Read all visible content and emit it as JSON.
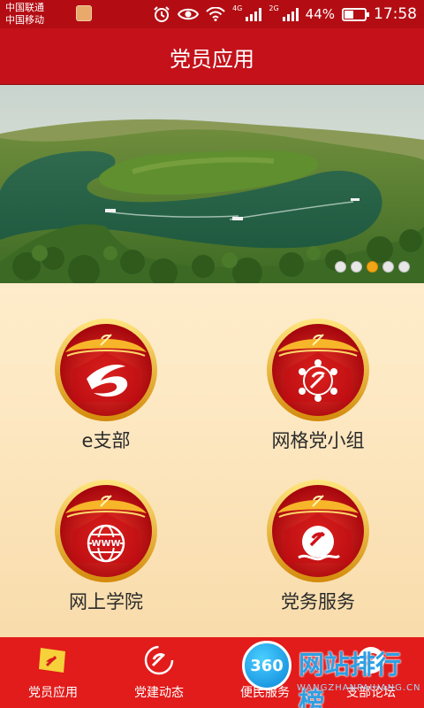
{
  "status_bar": {
    "carrier_1": "中国联通",
    "carrier_2": "中国移动",
    "network_1": "4G",
    "network_2": "2G",
    "battery": "44%",
    "battery_level": 0.44,
    "time": "17:58",
    "icons": [
      "app-icon",
      "alarm-icon",
      "eye-icon",
      "wifi-icon",
      "signal-icon",
      "signal-icon",
      "battery-icon"
    ]
  },
  "header": {
    "title": "党员应用"
  },
  "banner": {
    "slide_count": 5,
    "active_slide": 3
  },
  "apps": [
    {
      "label": "e支部",
      "icon": "e-branch-icon"
    },
    {
      "label": "网格党小组",
      "icon": "network-party-icon"
    },
    {
      "label": "网上学院",
      "icon": "www-globe-icon"
    },
    {
      "label": "党务服务",
      "icon": "party-service-icon"
    }
  ],
  "bottom_nav": [
    {
      "label": "党员应用",
      "icon": "party-flag-icon",
      "active": true
    },
    {
      "label": "党建动态",
      "icon": "party-emblem-icon",
      "active": false
    },
    {
      "label": "便民服务",
      "icon": "house-icon",
      "active": false
    },
    {
      "label": "支部论坛",
      "icon": "forum-emblem-icon",
      "active": false
    }
  ],
  "watermark": {
    "badge": "360",
    "title": "网站排行榜",
    "subtitle": "WANGZHANPAIHANG.CN"
  },
  "colors": {
    "status_bar": "#b30d13",
    "title_bar": "#c4111a",
    "bottom_nav": "#e21b1b",
    "gold": "#f2c230"
  }
}
